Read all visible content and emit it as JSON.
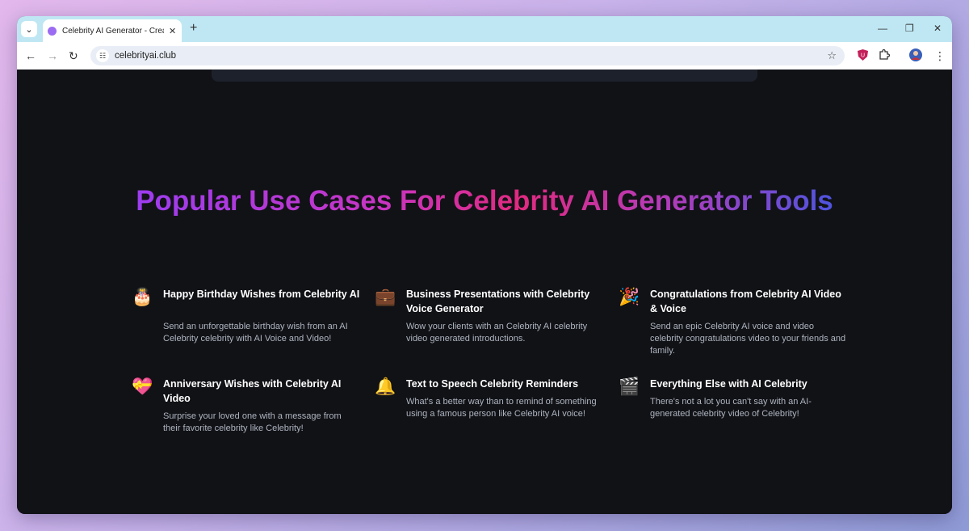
{
  "browser": {
    "tab_title": "Celebrity AI Generator - Create",
    "url": "celebrityai.club",
    "new_tab": "+",
    "tab_close": "✕",
    "minimize": "—",
    "restore": "❐",
    "close": "✕"
  },
  "page": {
    "heading": "Popular Use Cases For Celebrity AI Generator Tools",
    "cards": [
      {
        "icon": "birthday-cake-icon",
        "glyph": "🎂",
        "title": "Happy Birthday Wishes from Celebrity AI",
        "desc": "Send an unforgettable birthday wish from an AI Celebrity celebrity with AI Voice and Video!"
      },
      {
        "icon": "briefcase-icon",
        "glyph": "💼",
        "title": "Business Presentations with Celebrity Voice Generator",
        "desc": "Wow your clients with an Celebrity AI celebrity video generated introductions."
      },
      {
        "icon": "party-popper-icon",
        "glyph": "🎉",
        "title": "Congratulations from Celebrity AI Video & Voice",
        "desc": "Send an epic Celebrity AI voice and video celebrity congratulations video to your friends and family."
      },
      {
        "icon": "heart-gift-icon",
        "glyph": "💝",
        "title": "Anniversary Wishes with Celebrity AI Video",
        "desc": "Surprise your loved one with a message from their favorite celebrity like Celebrity!"
      },
      {
        "icon": "bell-icon",
        "glyph": "🔔",
        "title": "Text to Speech Celebrity Reminders",
        "desc": "What's a better way than to remind of something using a famous person like Celebrity AI voice!"
      },
      {
        "icon": "clapperboard-icon",
        "glyph": "🎬",
        "title": "Everything Else with AI Celebrity",
        "desc": "There's not a lot you can't say with an AI-generated celebrity video of Celebrity!"
      }
    ]
  },
  "colors": {
    "background": "#111216",
    "heading_gradient": [
      "#9b3df0",
      "#e02a80",
      "#4b55e0"
    ],
    "tabbar": "#bfe7f3"
  }
}
